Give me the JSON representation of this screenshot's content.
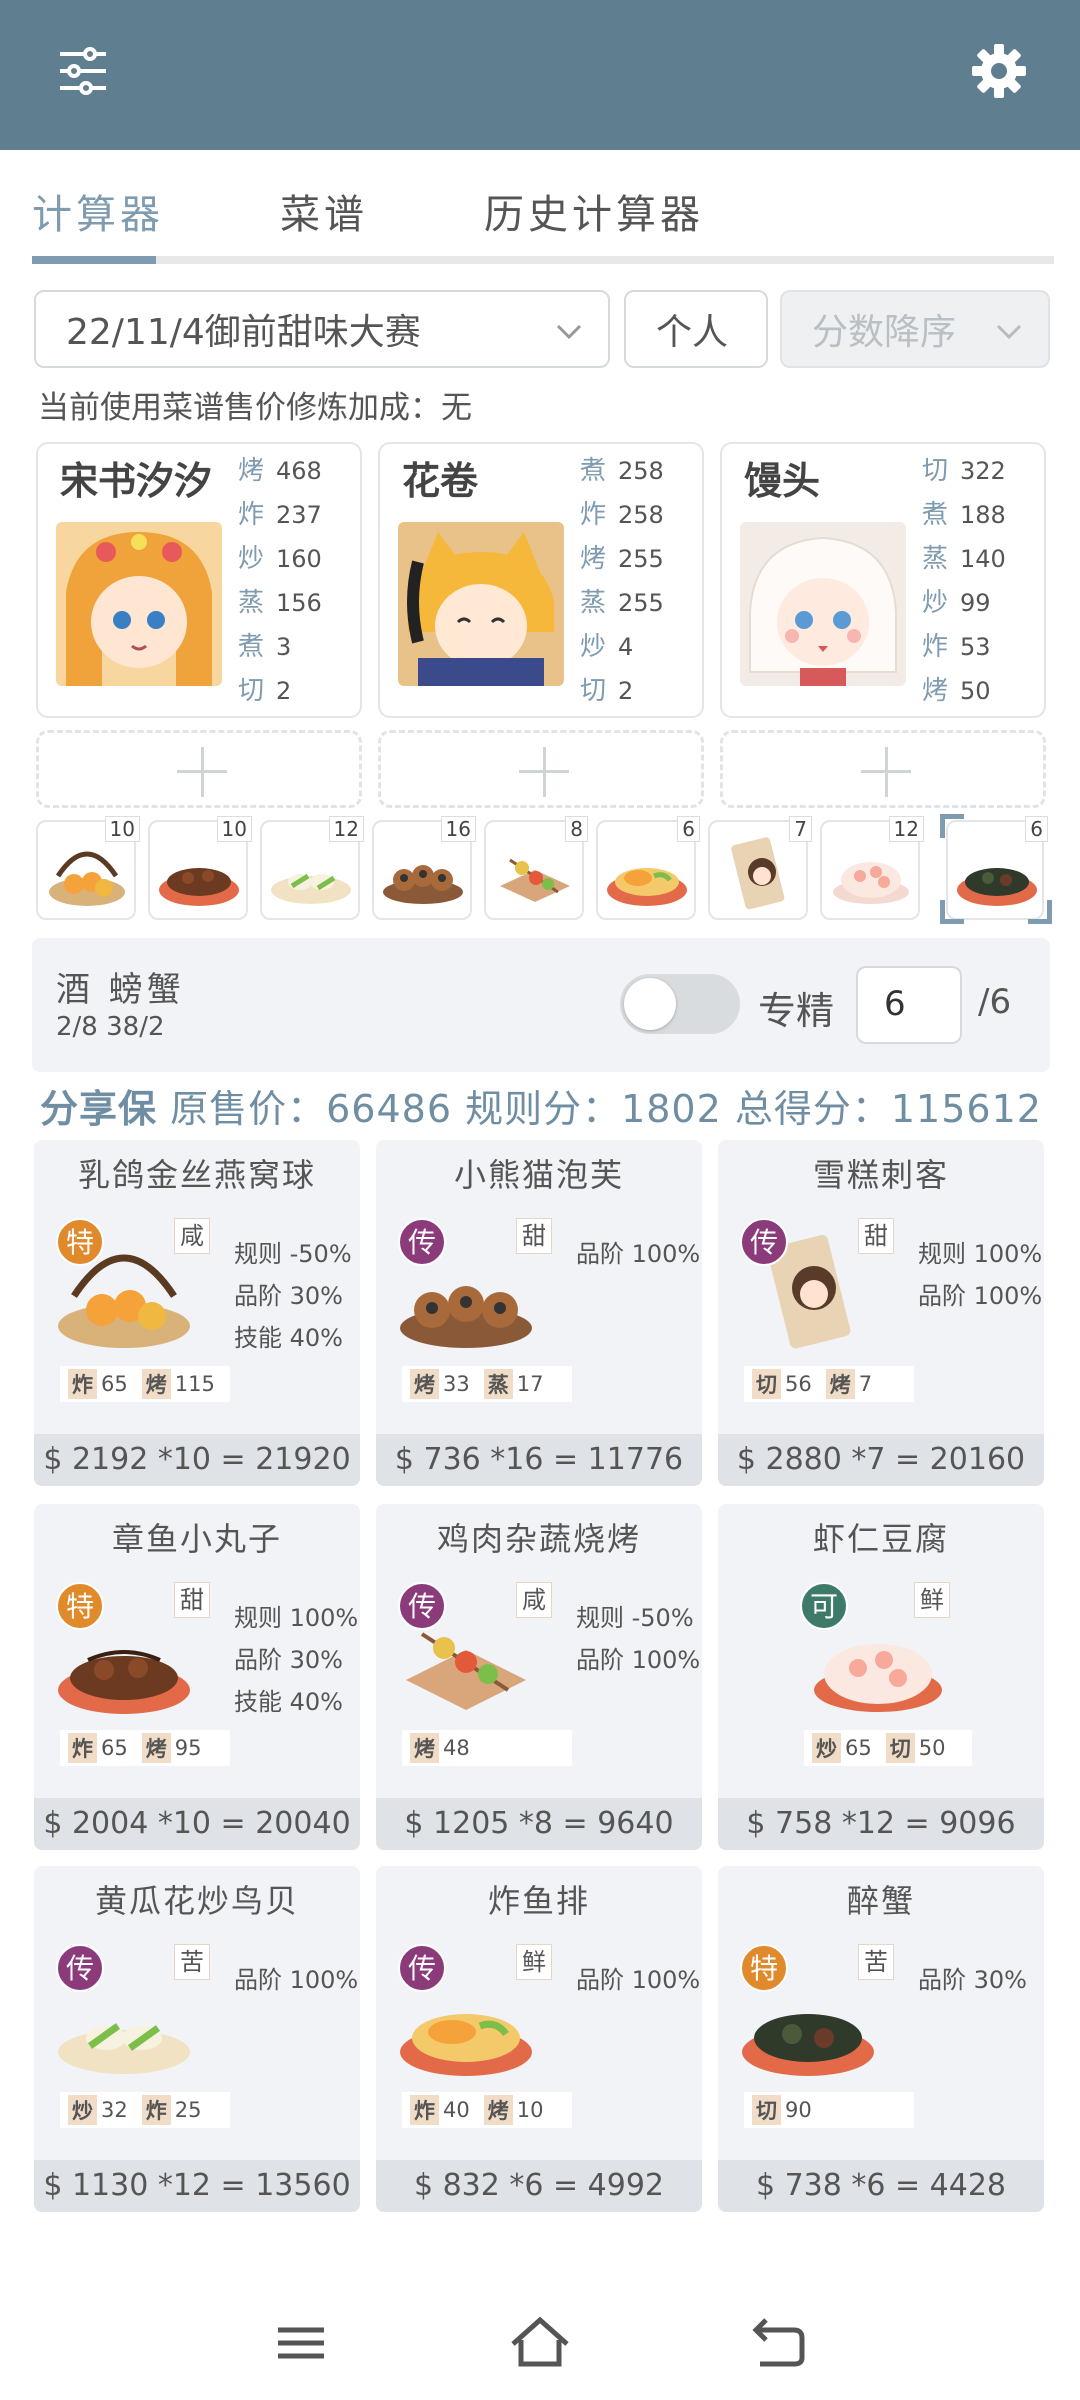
{
  "toolbar": {
    "menu_icon": "sliders-icon",
    "settings_icon": "gear-icon",
    "bg_color": "#5f7f90"
  },
  "tabs": [
    {
      "label": "计算器",
      "active": true
    },
    {
      "label": "菜谱",
      "active": false
    },
    {
      "label": "历史计算器",
      "active": false
    }
  ],
  "filters": {
    "event": "22/11/4御前甜味大赛",
    "mode": "个人",
    "sort": "分数降序"
  },
  "info_line": "当前使用菜谱售价修炼加成：无",
  "chefs": [
    {
      "name": "宋书汐汐",
      "stats": [
        {
          "k": "烤",
          "v": "468"
        },
        {
          "k": "炸",
          "v": "237"
        },
        {
          "k": "炒",
          "v": "160"
        },
        {
          "k": "蒸",
          "v": "156"
        },
        {
          "k": "煮",
          "v": "3"
        },
        {
          "k": "切",
          "v": "2"
        }
      ]
    },
    {
      "name": "花卷",
      "stats": [
        {
          "k": "煮",
          "v": "258"
        },
        {
          "k": "炸",
          "v": "258"
        },
        {
          "k": "烤",
          "v": "255"
        },
        {
          "k": "蒸",
          "v": "255"
        },
        {
          "k": "炒",
          "v": "4"
        },
        {
          "k": "切",
          "v": "2"
        }
      ]
    },
    {
      "name": "馒头",
      "stats": [
        {
          "k": "切",
          "v": "322"
        },
        {
          "k": "煮",
          "v": "188"
        },
        {
          "k": "蒸",
          "v": "140"
        },
        {
          "k": "炒",
          "v": "99"
        },
        {
          "k": "炸",
          "v": "53"
        },
        {
          "k": "烤",
          "v": "50"
        }
      ]
    }
  ],
  "dish_counts": [
    "10",
    "10",
    "12",
    "16",
    "8",
    "6",
    "7",
    "12",
    "6"
  ],
  "condition": {
    "title": "酒 螃蟹",
    "sub": "2/8 38/2",
    "spec_label": "专精",
    "spec_value": "6",
    "spec_total": "/6",
    "toggle_on": false
  },
  "summary": {
    "share": "分享保",
    "text": "原售价：66486 规则分：1802 总得分：115612"
  },
  "recipes": [
    {
      "name": "乳鸽金丝燕窝球",
      "rarity": "特",
      "rarity_color": "#e08a2c",
      "flavor": "咸",
      "bonuses": [
        "规则 -50%",
        "品阶 30%",
        "技能 40%"
      ],
      "skills": [
        {
          "k": "炸",
          "v": "65"
        },
        {
          "k": "烤",
          "v": "115"
        }
      ],
      "price": "$ 2192 *10 = 21920"
    },
    {
      "name": "小熊猫泡芙",
      "rarity": "传",
      "rarity_color": "#8b3a7a",
      "flavor": "甜",
      "bonuses": [
        "品阶 100%"
      ],
      "skills": [
        {
          "k": "烤",
          "v": "33"
        },
        {
          "k": "蒸",
          "v": "17"
        }
      ],
      "price": "$ 736 *16 = 11776"
    },
    {
      "name": "雪糕刺客",
      "rarity": "传",
      "rarity_color": "#8b3a7a",
      "flavor": "甜",
      "bonuses": [
        "规则 100%",
        "品阶 100%"
      ],
      "skills": [
        {
          "k": "切",
          "v": "56"
        },
        {
          "k": "烤",
          "v": "7"
        }
      ],
      "price": "$ 2880 *7 = 20160"
    },
    {
      "name": "章鱼小丸子",
      "rarity": "特",
      "rarity_color": "#e08a2c",
      "flavor": "甜",
      "bonuses": [
        "规则 100%",
        "品阶 30%",
        "技能 40%"
      ],
      "skills": [
        {
          "k": "炸",
          "v": "65"
        },
        {
          "k": "烤",
          "v": "95"
        }
      ],
      "price": "$ 2004 *10 = 20040"
    },
    {
      "name": "鸡肉杂蔬烧烤",
      "rarity": "传",
      "rarity_color": "#8b3a7a",
      "flavor": "咸",
      "bonuses": [
        "规则 -50%",
        "品阶 100%"
      ],
      "skills": [
        {
          "k": "烤",
          "v": "48"
        }
      ],
      "price": "$ 1205 *8 = 9640"
    },
    {
      "name": "虾仁豆腐",
      "rarity": "可",
      "rarity_color": "#3d7a6a",
      "flavor": "鲜",
      "bonuses": [],
      "skills": [
        {
          "k": "炒",
          "v": "65"
        },
        {
          "k": "切",
          "v": "50"
        }
      ],
      "price": "$ 758 *12 = 9096"
    },
    {
      "name": "黄瓜花炒鸟贝",
      "rarity": "传",
      "rarity_color": "#8b3a7a",
      "flavor": "苦",
      "bonuses": [
        "品阶 100%"
      ],
      "skills": [
        {
          "k": "炒",
          "v": "32"
        },
        {
          "k": "炸",
          "v": "25"
        }
      ],
      "price": "$ 1130 *12 = 13560"
    },
    {
      "name": "炸鱼排",
      "rarity": "传",
      "rarity_color": "#8b3a7a",
      "flavor": "鲜",
      "bonuses": [
        "品阶 100%"
      ],
      "skills": [
        {
          "k": "炸",
          "v": "40"
        },
        {
          "k": "烤",
          "v": "10"
        }
      ],
      "price": "$ 832 *6 = 4992"
    },
    {
      "name": "醉蟹",
      "rarity": "特",
      "rarity_color": "#e08a2c",
      "flavor": "苦",
      "bonuses": [
        "品阶 30%"
      ],
      "skills": [
        {
          "k": "切",
          "v": "90"
        }
      ],
      "price": "$ 738 *6 = 4428"
    }
  ],
  "nav": {
    "menu_icon": "hamburger-icon",
    "home_icon": "home-icon",
    "back_icon": "back-icon"
  }
}
